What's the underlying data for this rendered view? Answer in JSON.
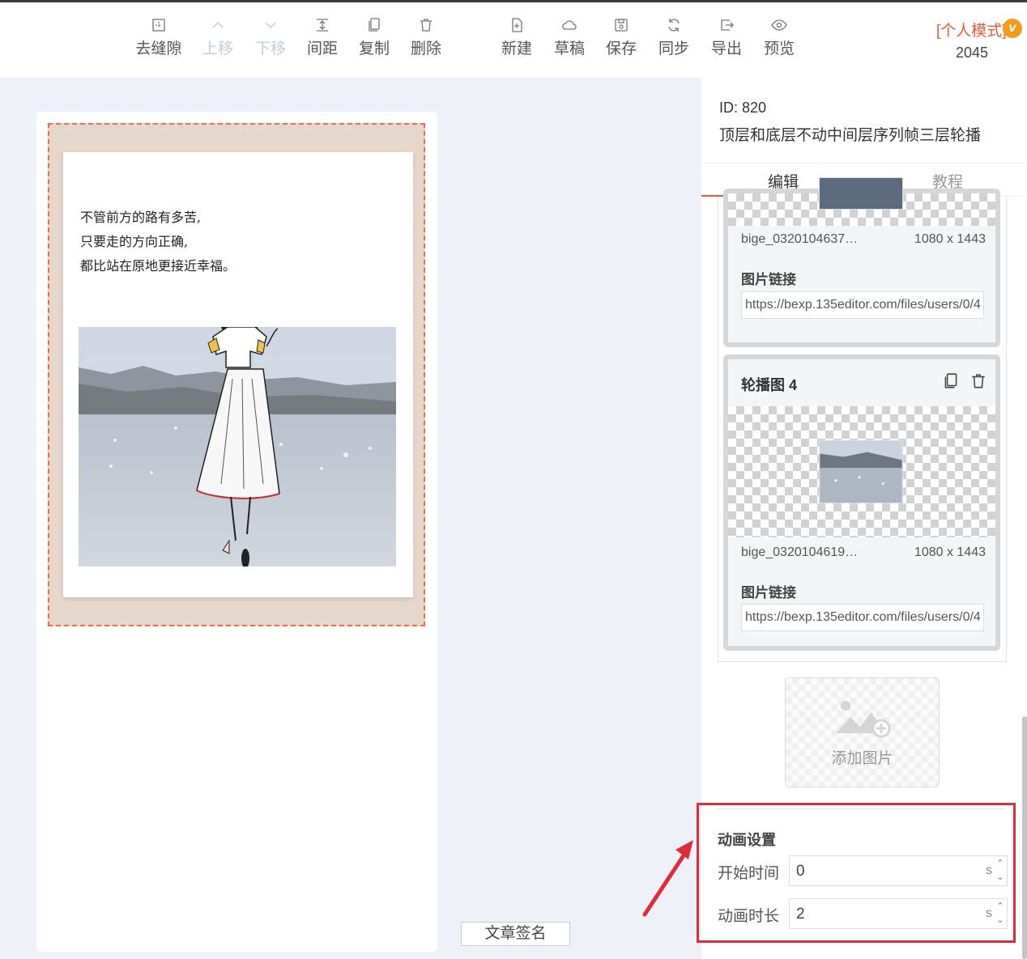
{
  "toolbar": {
    "items": [
      {
        "label": "去缝隙",
        "icon": "gap-icon",
        "disabled": false
      },
      {
        "label": "上移",
        "icon": "chevron-up-icon",
        "disabled": true
      },
      {
        "label": "下移",
        "icon": "chevron-down-icon",
        "disabled": true
      },
      {
        "label": "间距",
        "icon": "spacing-icon",
        "disabled": false
      },
      {
        "label": "复制",
        "icon": "copy-icon",
        "disabled": false
      },
      {
        "label": "删除",
        "icon": "trash-icon",
        "disabled": false
      },
      {
        "label": "新建",
        "icon": "new-file-icon",
        "disabled": false
      },
      {
        "label": "草稿",
        "icon": "cloud-icon",
        "disabled": false
      },
      {
        "label": "保存",
        "icon": "save-icon",
        "disabled": false
      },
      {
        "label": "同步",
        "icon": "sync-icon",
        "disabled": false
      },
      {
        "label": "导出",
        "icon": "export-icon",
        "disabled": false
      },
      {
        "label": "预览",
        "icon": "eye-icon",
        "disabled": false
      }
    ],
    "mode_label": "[个人模式]",
    "badge": "v",
    "count": "2045"
  },
  "canvas": {
    "poem_lines": [
      "不管前方的路有多苦,",
      "只要走的方向正确,",
      "都比站在原地更接近幸福。"
    ],
    "signature_button": "文章签名"
  },
  "panel": {
    "id_text": "ID: 820",
    "template_name": "顶层和底层不动中间层序列帧三层轮播",
    "tabs": [
      "编辑",
      "教程"
    ],
    "slides": [
      {
        "file_name": "bige_0320104637…",
        "size": "1080 x 1443",
        "link_label": "图片链接",
        "link_value": "https://bexp.135editor.com/files/users/0/4"
      },
      {
        "title": "轮播图 4",
        "file_name": "bige_0320104619…",
        "size": "1080 x 1443",
        "link_label": "图片链接",
        "link_value": "https://bexp.135editor.com/files/users/0/4"
      }
    ],
    "add_image_label": "添加图片",
    "animation": {
      "title": "动画设置",
      "start_label": "开始时间",
      "start_value": "0",
      "duration_label": "动画时长",
      "duration_value": "2",
      "unit": "s"
    }
  },
  "colors": {
    "accent": "#ec5a3a",
    "highlight": "#e02d3c",
    "template_bg": "#e6d7cc"
  }
}
